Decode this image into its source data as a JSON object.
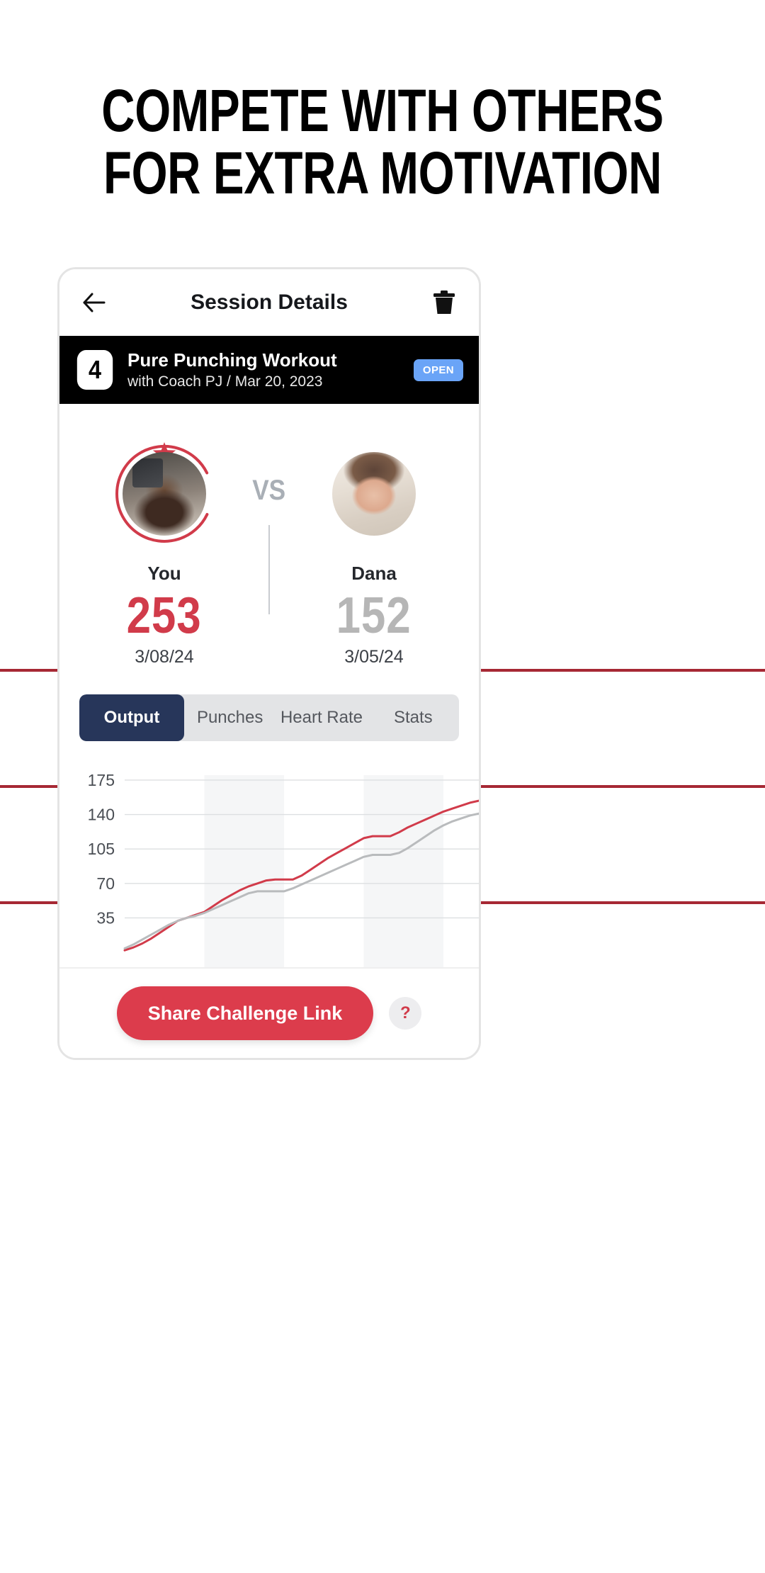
{
  "headline": {
    "line1": "COMPETE WITH OTHERS",
    "line2": "FOR EXTRA MOTIVATION"
  },
  "nav": {
    "back_icon": "arrow-left-icon",
    "title": "Session Details",
    "delete_icon": "trash-icon"
  },
  "banner": {
    "number": "4",
    "title": "Pure Punching Workout",
    "subtitle": "with Coach PJ / Mar 20, 2023",
    "badge": "OPEN",
    "badge_color": "#6AA4F7",
    "background": "#000000"
  },
  "versus": {
    "separator": "VS",
    "left": {
      "name": "You",
      "score": "253",
      "date": "3/08/24",
      "score_color": "#D13B4A",
      "is_winner": true,
      "avatar": "photo-male-boxer",
      "ring": "winner-ring-with-star"
    },
    "right": {
      "name": "Dana",
      "score": "152",
      "date": "3/05/24",
      "score_color": "#B6B6B6",
      "is_winner": false,
      "avatar": "photo-female-athlete"
    }
  },
  "tabs": {
    "items": [
      {
        "label": "Output",
        "active": true
      },
      {
        "label": "Punches",
        "active": false
      },
      {
        "label": "Heart Rate",
        "active": false
      },
      {
        "label": "Stats",
        "active": false
      }
    ],
    "active_color": "#27365A",
    "track_color": "#E3E4E6"
  },
  "chart_data": {
    "type": "line",
    "title": "",
    "xlabel": "",
    "ylabel": "",
    "grid": true,
    "legend": "none",
    "ylim": [
      0,
      180
    ],
    "yticks": [
      35,
      70,
      105,
      140,
      175
    ],
    "ytick_labels": [
      "35",
      "70",
      "105",
      "140",
      "175"
    ],
    "x": [
      0,
      1,
      2,
      3,
      4,
      5,
      6,
      7,
      8,
      9,
      10,
      11,
      12,
      13,
      14,
      15,
      16,
      17,
      18,
      19,
      20,
      21,
      22,
      23,
      24,
      25,
      26,
      27,
      28,
      29,
      30,
      31,
      32,
      33,
      34,
      35,
      36,
      37,
      38,
      39,
      40
    ],
    "band_ranges": [
      [
        9,
        18
      ],
      [
        27,
        36
      ]
    ],
    "band_color": "#F5F6F7",
    "series": [
      {
        "name": "You",
        "color": "#D13B4A",
        "values": [
          2,
          5,
          9,
          14,
          20,
          26,
          32,
          35,
          38,
          41,
          47,
          53,
          58,
          63,
          67,
          70,
          73,
          74,
          74,
          74,
          78,
          84,
          90,
          96,
          101,
          106,
          111,
          116,
          118,
          118,
          118,
          122,
          127,
          131,
          135,
          139,
          143,
          146,
          149,
          152,
          154
        ]
      },
      {
        "name": "Dana",
        "color": "#B9BBBD",
        "values": [
          4,
          8,
          13,
          18,
          23,
          28,
          32,
          35,
          37,
          40,
          44,
          48,
          52,
          56,
          60,
          62,
          62,
          62,
          62,
          65,
          69,
          73,
          77,
          81,
          85,
          89,
          93,
          97,
          99,
          99,
          99,
          101,
          106,
          112,
          118,
          124,
          129,
          133,
          136,
          139,
          141
        ]
      }
    ]
  },
  "footer": {
    "share_label": "Share Challenge Link",
    "share_color": "#DC3C4C",
    "help_label": "?"
  },
  "decor": {
    "rule_color": "#A62834"
  }
}
